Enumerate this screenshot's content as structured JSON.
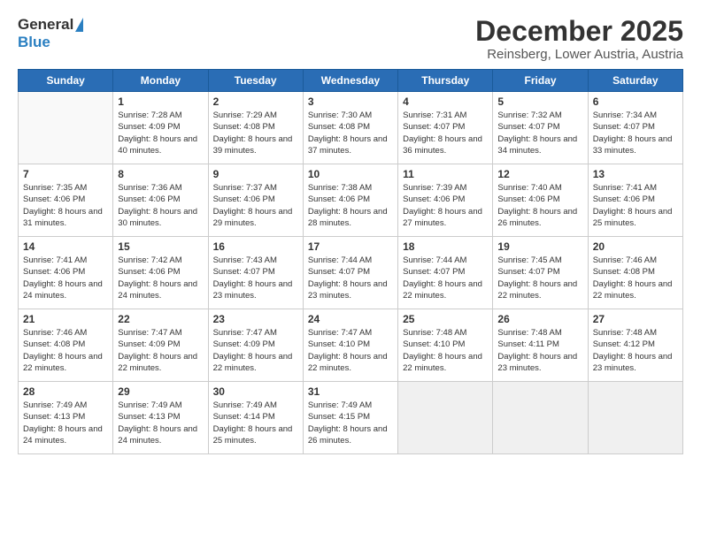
{
  "logo": {
    "general": "General",
    "blue": "Blue"
  },
  "title": {
    "month": "December 2025",
    "location": "Reinsberg, Lower Austria, Austria"
  },
  "weekdays": [
    "Sunday",
    "Monday",
    "Tuesday",
    "Wednesday",
    "Thursday",
    "Friday",
    "Saturday"
  ],
  "weeks": [
    [
      {
        "day": "",
        "sunrise": "",
        "sunset": "",
        "daylight": "",
        "empty": true
      },
      {
        "day": "1",
        "sunrise": "Sunrise: 7:28 AM",
        "sunset": "Sunset: 4:09 PM",
        "daylight": "Daylight: 8 hours and 40 minutes."
      },
      {
        "day": "2",
        "sunrise": "Sunrise: 7:29 AM",
        "sunset": "Sunset: 4:08 PM",
        "daylight": "Daylight: 8 hours and 39 minutes."
      },
      {
        "day": "3",
        "sunrise": "Sunrise: 7:30 AM",
        "sunset": "Sunset: 4:08 PM",
        "daylight": "Daylight: 8 hours and 37 minutes."
      },
      {
        "day": "4",
        "sunrise": "Sunrise: 7:31 AM",
        "sunset": "Sunset: 4:07 PM",
        "daylight": "Daylight: 8 hours and 36 minutes."
      },
      {
        "day": "5",
        "sunrise": "Sunrise: 7:32 AM",
        "sunset": "Sunset: 4:07 PM",
        "daylight": "Daylight: 8 hours and 34 minutes."
      },
      {
        "day": "6",
        "sunrise": "Sunrise: 7:34 AM",
        "sunset": "Sunset: 4:07 PM",
        "daylight": "Daylight: 8 hours and 33 minutes."
      }
    ],
    [
      {
        "day": "7",
        "sunrise": "Sunrise: 7:35 AM",
        "sunset": "Sunset: 4:06 PM",
        "daylight": "Daylight: 8 hours and 31 minutes."
      },
      {
        "day": "8",
        "sunrise": "Sunrise: 7:36 AM",
        "sunset": "Sunset: 4:06 PM",
        "daylight": "Daylight: 8 hours and 30 minutes."
      },
      {
        "day": "9",
        "sunrise": "Sunrise: 7:37 AM",
        "sunset": "Sunset: 4:06 PM",
        "daylight": "Daylight: 8 hours and 29 minutes."
      },
      {
        "day": "10",
        "sunrise": "Sunrise: 7:38 AM",
        "sunset": "Sunset: 4:06 PM",
        "daylight": "Daylight: 8 hours and 28 minutes."
      },
      {
        "day": "11",
        "sunrise": "Sunrise: 7:39 AM",
        "sunset": "Sunset: 4:06 PM",
        "daylight": "Daylight: 8 hours and 27 minutes."
      },
      {
        "day": "12",
        "sunrise": "Sunrise: 7:40 AM",
        "sunset": "Sunset: 4:06 PM",
        "daylight": "Daylight: 8 hours and 26 minutes."
      },
      {
        "day": "13",
        "sunrise": "Sunrise: 7:41 AM",
        "sunset": "Sunset: 4:06 PM",
        "daylight": "Daylight: 8 hours and 25 minutes."
      }
    ],
    [
      {
        "day": "14",
        "sunrise": "Sunrise: 7:41 AM",
        "sunset": "Sunset: 4:06 PM",
        "daylight": "Daylight: 8 hours and 24 minutes."
      },
      {
        "day": "15",
        "sunrise": "Sunrise: 7:42 AM",
        "sunset": "Sunset: 4:06 PM",
        "daylight": "Daylight: 8 hours and 24 minutes."
      },
      {
        "day": "16",
        "sunrise": "Sunrise: 7:43 AM",
        "sunset": "Sunset: 4:07 PM",
        "daylight": "Daylight: 8 hours and 23 minutes."
      },
      {
        "day": "17",
        "sunrise": "Sunrise: 7:44 AM",
        "sunset": "Sunset: 4:07 PM",
        "daylight": "Daylight: 8 hours and 23 minutes."
      },
      {
        "day": "18",
        "sunrise": "Sunrise: 7:44 AM",
        "sunset": "Sunset: 4:07 PM",
        "daylight": "Daylight: 8 hours and 22 minutes."
      },
      {
        "day": "19",
        "sunrise": "Sunrise: 7:45 AM",
        "sunset": "Sunset: 4:07 PM",
        "daylight": "Daylight: 8 hours and 22 minutes."
      },
      {
        "day": "20",
        "sunrise": "Sunrise: 7:46 AM",
        "sunset": "Sunset: 4:08 PM",
        "daylight": "Daylight: 8 hours and 22 minutes."
      }
    ],
    [
      {
        "day": "21",
        "sunrise": "Sunrise: 7:46 AM",
        "sunset": "Sunset: 4:08 PM",
        "daylight": "Daylight: 8 hours and 22 minutes."
      },
      {
        "day": "22",
        "sunrise": "Sunrise: 7:47 AM",
        "sunset": "Sunset: 4:09 PM",
        "daylight": "Daylight: 8 hours and 22 minutes."
      },
      {
        "day": "23",
        "sunrise": "Sunrise: 7:47 AM",
        "sunset": "Sunset: 4:09 PM",
        "daylight": "Daylight: 8 hours and 22 minutes."
      },
      {
        "day": "24",
        "sunrise": "Sunrise: 7:47 AM",
        "sunset": "Sunset: 4:10 PM",
        "daylight": "Daylight: 8 hours and 22 minutes."
      },
      {
        "day": "25",
        "sunrise": "Sunrise: 7:48 AM",
        "sunset": "Sunset: 4:10 PM",
        "daylight": "Daylight: 8 hours and 22 minutes."
      },
      {
        "day": "26",
        "sunrise": "Sunrise: 7:48 AM",
        "sunset": "Sunset: 4:11 PM",
        "daylight": "Daylight: 8 hours and 23 minutes."
      },
      {
        "day": "27",
        "sunrise": "Sunrise: 7:48 AM",
        "sunset": "Sunset: 4:12 PM",
        "daylight": "Daylight: 8 hours and 23 minutes."
      }
    ],
    [
      {
        "day": "28",
        "sunrise": "Sunrise: 7:49 AM",
        "sunset": "Sunset: 4:13 PM",
        "daylight": "Daylight: 8 hours and 24 minutes."
      },
      {
        "day": "29",
        "sunrise": "Sunrise: 7:49 AM",
        "sunset": "Sunset: 4:13 PM",
        "daylight": "Daylight: 8 hours and 24 minutes."
      },
      {
        "day": "30",
        "sunrise": "Sunrise: 7:49 AM",
        "sunset": "Sunset: 4:14 PM",
        "daylight": "Daylight: 8 hours and 25 minutes."
      },
      {
        "day": "31",
        "sunrise": "Sunrise: 7:49 AM",
        "sunset": "Sunset: 4:15 PM",
        "daylight": "Daylight: 8 hours and 26 minutes."
      },
      {
        "day": "",
        "sunrise": "",
        "sunset": "",
        "daylight": "",
        "empty": true
      },
      {
        "day": "",
        "sunrise": "",
        "sunset": "",
        "daylight": "",
        "empty": true
      },
      {
        "day": "",
        "sunrise": "",
        "sunset": "",
        "daylight": "",
        "empty": true
      }
    ]
  ]
}
